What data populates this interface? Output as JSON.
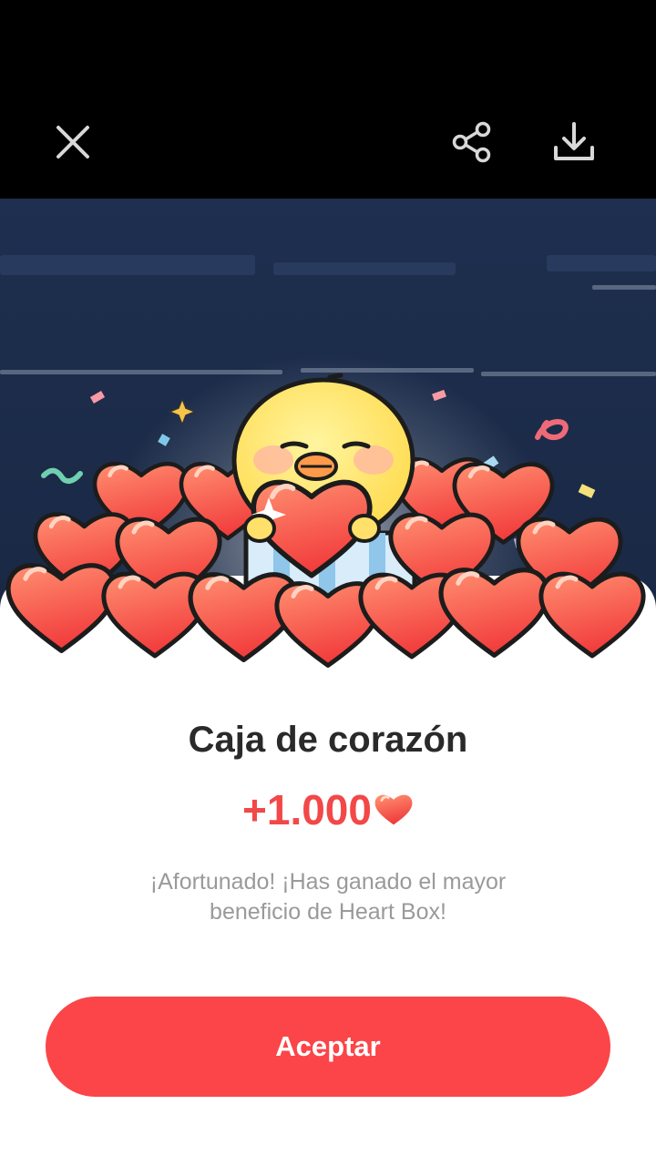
{
  "toolbar": {
    "close_icon": "close-icon",
    "share_icon": "share-icon",
    "download_icon": "download-icon"
  },
  "dialog": {
    "title": "Caja de corazón",
    "reward_amount": "+1.000",
    "reward_icon": "heart-icon",
    "message": "¡Afortunado! ¡Has ganado el mayor beneficio de Heart Box!",
    "accept_label": "Aceptar"
  },
  "colors": {
    "accent": "#fb4548",
    "reward_text": "#f24848",
    "title_text": "#2a2a2a",
    "message_text": "#9a9a9a"
  }
}
